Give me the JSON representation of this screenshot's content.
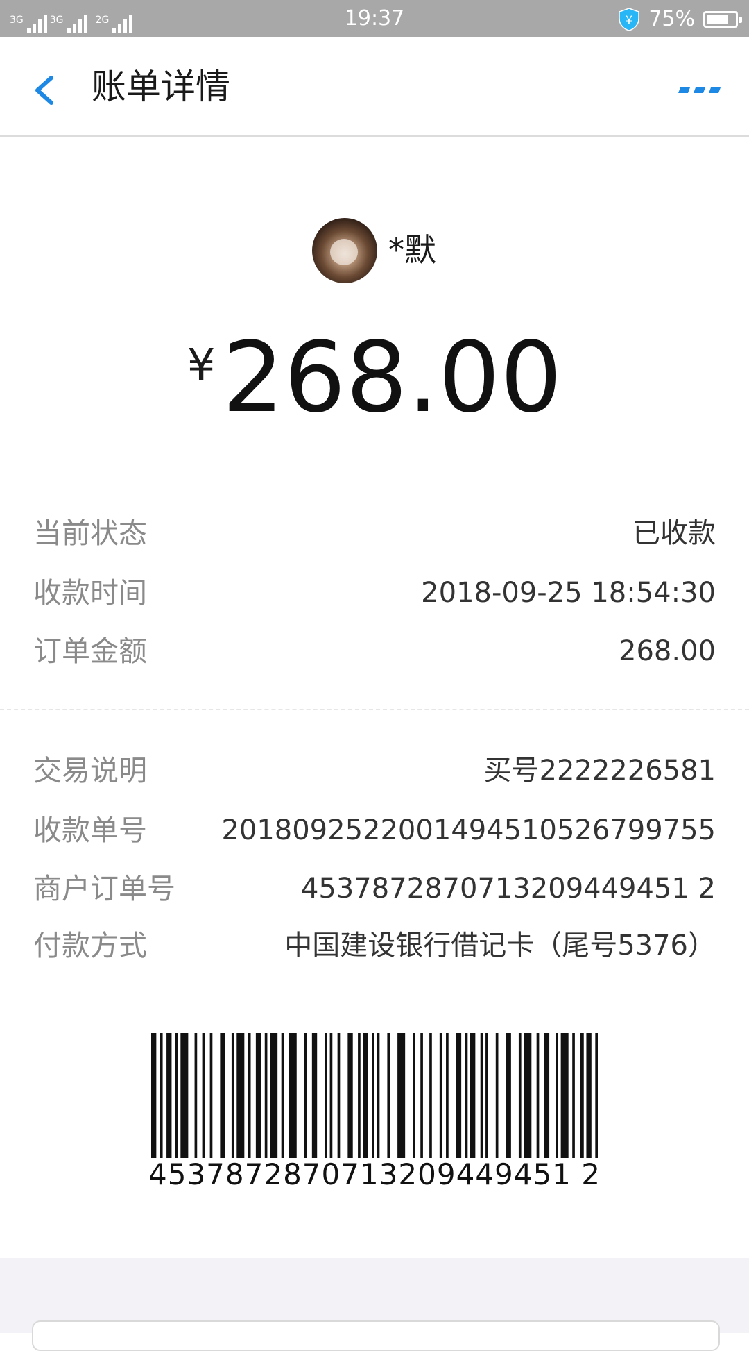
{
  "status_bar": {
    "network_1": "3G",
    "network_2": "3G",
    "network_3": "2G",
    "time": "19:37",
    "battery_percent": "75%",
    "battery_level": 0.75,
    "shield_icon": "security-shield-yen-icon"
  },
  "header": {
    "title": "账单详情",
    "back_icon": "chevron-left-icon",
    "more_icon": "more-dots-icon",
    "accent_color": "#1e88e5"
  },
  "payer": {
    "name": "*默",
    "avatar_icon": "avatar-photo"
  },
  "amount": {
    "currency_symbol": "¥",
    "value": "268.00"
  },
  "details_group_1": [
    {
      "label": "当前状态",
      "value": "已收款"
    },
    {
      "label": "收款时间",
      "value": "2018-09-25 18:54:30"
    },
    {
      "label": "订单金额",
      "value": "268.00"
    }
  ],
  "details_group_2": [
    {
      "label": "交易说明",
      "value": "买号2222226581"
    },
    {
      "label": "收款单号",
      "value": "2018092522001494510526799755"
    },
    {
      "label": "商户订单号",
      "value": "4537872870713209449451 2"
    },
    {
      "label": "付款方式",
      "value": "中国建设银行借记卡（尾号5376）"
    }
  ],
  "barcode": {
    "number": "4537872870713209449451 2"
  }
}
